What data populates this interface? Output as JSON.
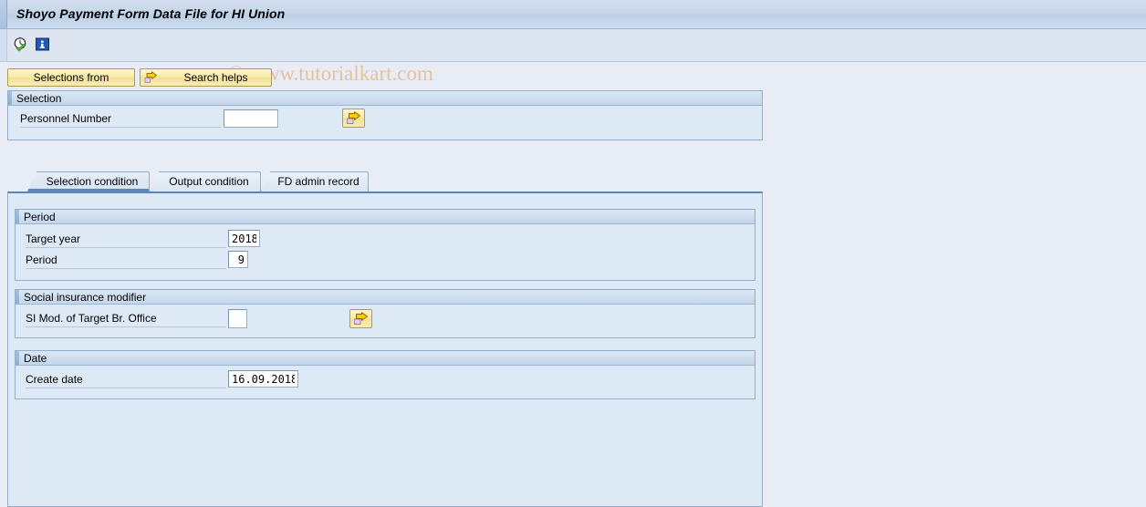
{
  "window": {
    "title": "Shoyo Payment Form Data File for HI Union"
  },
  "toolbar": {
    "icons": [
      {
        "name": "execute-clock-icon",
        "title": "Execute"
      },
      {
        "name": "info-icon",
        "title": "Information"
      }
    ]
  },
  "watermark": {
    "text": "© www.tutorialkart.com",
    "color": "#e8b98a"
  },
  "buttons": {
    "selections_from": "Selections from",
    "search_helps": "Search helps"
  },
  "selection_group": {
    "title": "Selection",
    "personnel_number": {
      "label": "Personnel Number",
      "value": "",
      "placeholder": "",
      "value_help_icon": "arrow-right-icon"
    }
  },
  "tabs": [
    {
      "id": "selection-condition",
      "label": "Selection condition",
      "active": true
    },
    {
      "id": "output-condition",
      "label": "Output condition",
      "active": false
    },
    {
      "id": "fd-admin-record",
      "label": "FD admin record",
      "active": false
    }
  ],
  "period_group": {
    "title": "Period",
    "target_year": {
      "label": "Target year",
      "value": "2018"
    },
    "period": {
      "label": "Period",
      "value": "9"
    }
  },
  "si_group": {
    "title": "Social insurance modifier",
    "si_mod": {
      "label": "SI Mod. of Target Br. Office",
      "value": "",
      "value_help_icon": "arrow-right-icon"
    }
  },
  "date_group": {
    "title": "Date",
    "create_date": {
      "label": "Create date",
      "value": "16.09.2018"
    }
  },
  "colors": {
    "background": "#e8edf5",
    "panel": "#ddeaf5",
    "border": "#90aecb",
    "accent": "#5d87b8",
    "button": "#f7e9a6"
  }
}
